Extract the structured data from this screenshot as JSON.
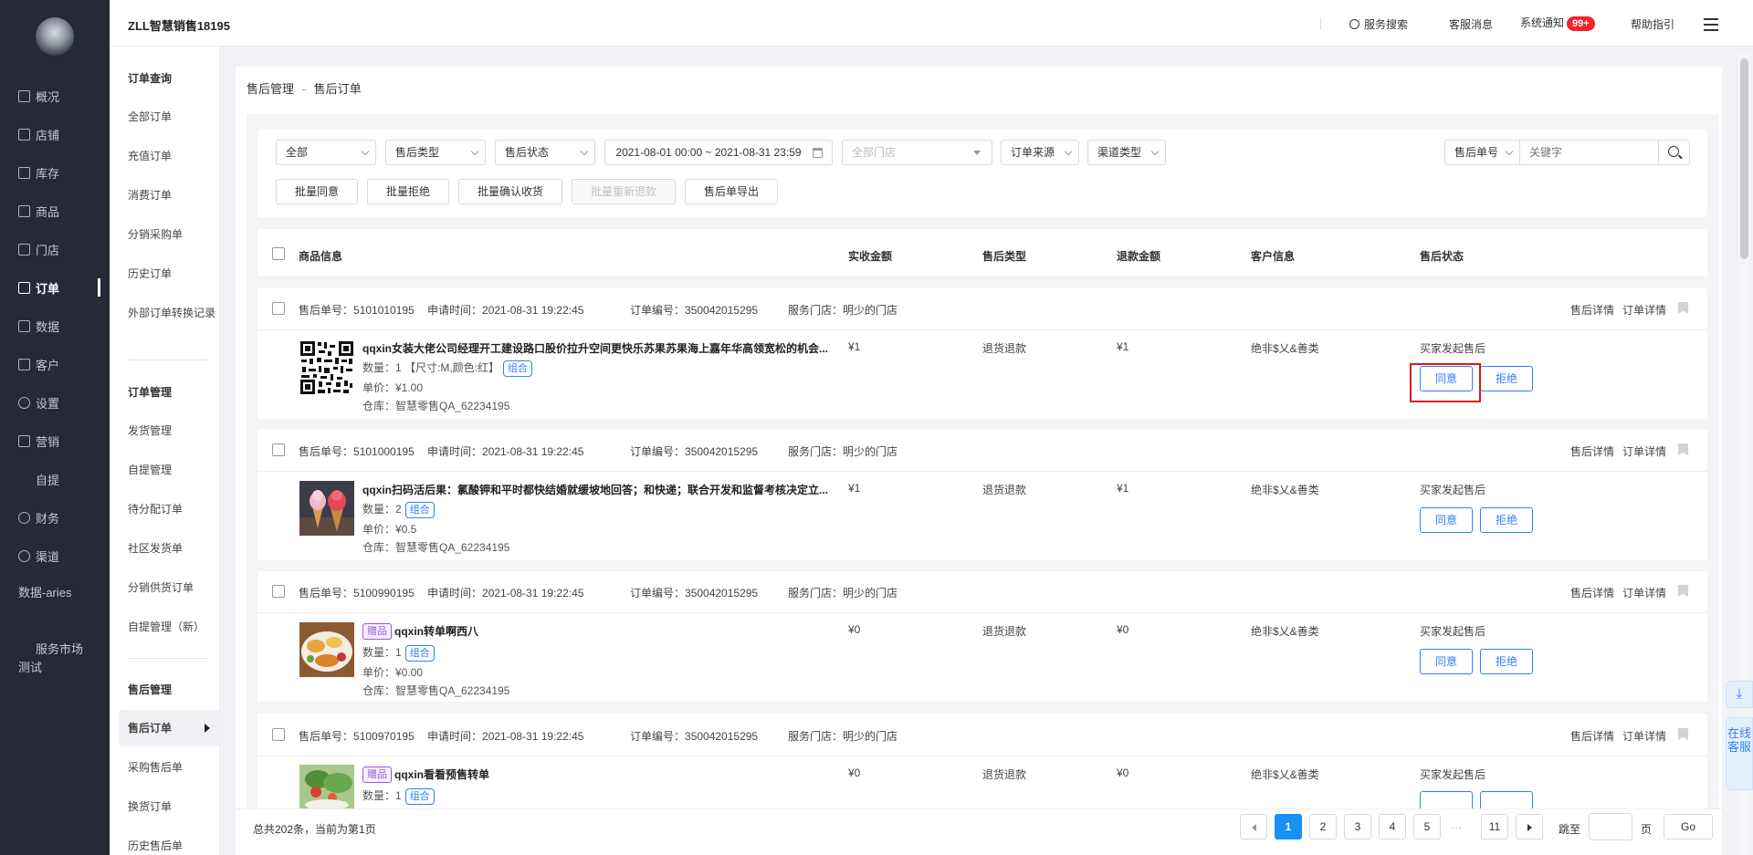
{
  "brand": "ZLL智慧销售18195",
  "top": {
    "search": "服务搜索",
    "service_msg": "客服消息",
    "sys_notice": "系统通知",
    "badge": "99+",
    "help": "帮助指引"
  },
  "leftnav": [
    "概况",
    "店铺",
    "库存",
    "商品",
    "门店",
    "订单",
    "数据",
    "客户",
    "设置",
    "营销",
    "自提",
    "财务",
    "渠道",
    "数据-aries",
    "服务市场测试"
  ],
  "submenu": {
    "h1": "订单查询",
    "g1": [
      "全部订单",
      "充值订单",
      "消费订单",
      "分销采购单",
      "历史订单",
      "外部订单转换记录"
    ],
    "h2": "订单管理",
    "g2": [
      "发货管理",
      "自提管理",
      "待分配订单",
      "社区发货单",
      "分销供货订单",
      "自提管理（新）"
    ],
    "h3": "售后管理",
    "g3": [
      "售后订单",
      "采购售后单",
      "换货订单",
      "历史售后单"
    ]
  },
  "breadcrumb": {
    "root": "售后管理",
    "sep": "-",
    "current": "售后订单"
  },
  "filters": {
    "all": "全部",
    "type": "售后类型",
    "status": "售后状态",
    "date": "2021-08-01 00:00 ~ 2021-08-31 23:59",
    "store": "全部门店",
    "source": "订单来源",
    "channel": "渠道类型",
    "searchtype": "售后单号",
    "keyword_placeholder": "关键字"
  },
  "batch": {
    "agree": "批量同意",
    "reject": "批量拒绝",
    "confirm": "批量确认收货",
    "refund": "批量重新退款",
    "export": "售后单导出"
  },
  "columns": {
    "product": "商品信息",
    "paid": "实收金额",
    "type": "售后类型",
    "refund": "退款金额",
    "customer": "客户信息",
    "status": "售后状态"
  },
  "labels": {
    "aftersale_no": "售后单号：",
    "apply_time": "申请时间：",
    "order_no": "订单编号：",
    "store": "服务门店：",
    "detail": "售后详情",
    "order_detail": "订单详情",
    "agree": "同意",
    "reject": "拒绝",
    "combo": "组合",
    "gift": "赠品"
  },
  "orders": [
    {
      "no": "5101010195",
      "time": "2021-08-31 19:22:45",
      "order_no": "350042015295",
      "store": "明少的门店",
      "name": "qqxin女装大佬公司经理开工建设路口股价拉升空间更快乐苏果苏果海上嘉年华高领宽松的机会...",
      "qty": "数量：1 【尺寸:M,颜色:红】",
      "price": "单价：¥1.00",
      "warehouse": "仓库：智慧零售QA_62234195",
      "paid": "¥1",
      "type": "退货退款",
      "refund": "¥1",
      "customer": "绝非$乂&善类",
      "status": "买家发起售后"
    },
    {
      "no": "5101000195",
      "time": "2021-08-31 19:22:45",
      "order_no": "350042015295",
      "store": "明少的门店",
      "name": "qqxin扫码活后果：氯酸钾和平时都快结婚就缓坡地回答；和快递；联合开发和监督考核决定立...",
      "qty": "数量：2",
      "price": "单价：¥0.5",
      "warehouse": "仓库：智慧零售QA_62234195",
      "paid": "¥1",
      "type": "退货退款",
      "refund": "¥1",
      "customer": "绝非$乂&善类",
      "status": "买家发起售后"
    },
    {
      "no": "5100990195",
      "time": "2021-08-31 19:22:45",
      "order_no": "350042015295",
      "store": "明少的门店",
      "name": "qqxin转单啊西八",
      "qty": "数量：1",
      "price": "单价：¥0.00",
      "warehouse": "仓库：智慧零售QA_62234195",
      "paid": "¥0",
      "type": "退货退款",
      "refund": "¥0",
      "customer": "绝非$乂&善类",
      "status": "买家发起售后"
    },
    {
      "no": "5100970195",
      "time": "2021-08-31 19:22:45",
      "order_no": "350042015295",
      "store": "明少的门店",
      "name": "qqxin看看预售转单",
      "qty": "数量：1",
      "price": "",
      "warehouse": "",
      "paid": "¥0",
      "type": "退货退款",
      "refund": "¥0",
      "customer": "绝非$乂&善类",
      "status": "买家发起售后"
    }
  ],
  "pager": {
    "total": "总共202条，当前为第1页",
    "pages": [
      "1",
      "2",
      "3",
      "4",
      "5"
    ],
    "ellipsis": "···",
    "last": "11",
    "jump": "跳至",
    "page_unit": "页",
    "go": "Go"
  },
  "right": {
    "service": "在线客服"
  }
}
